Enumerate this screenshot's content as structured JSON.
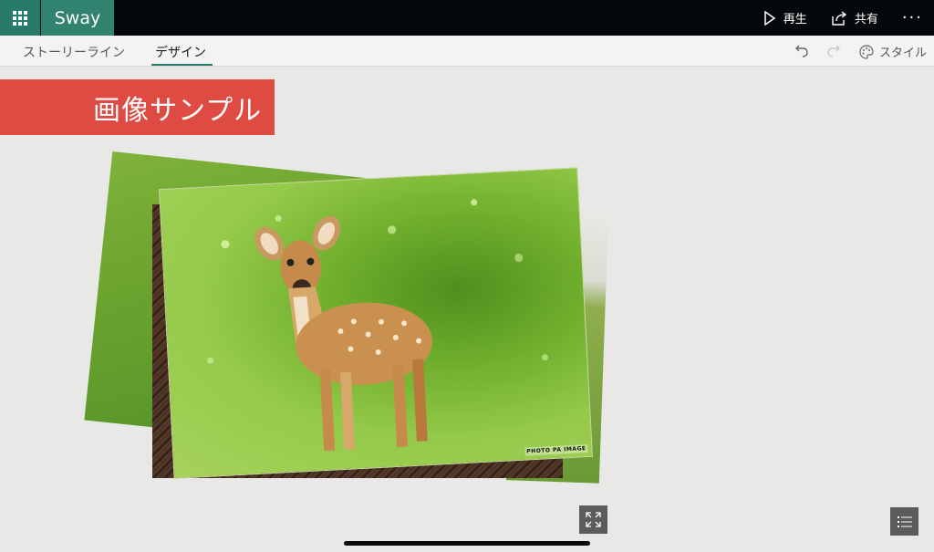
{
  "app": {
    "name": "Sway"
  },
  "topbar": {
    "play_label": "再生",
    "share_label": "共有",
    "more_label": "···"
  },
  "tabs": [
    {
      "label": "ストーリーライン",
      "active": false
    },
    {
      "label": "デザイン",
      "active": true
    }
  ],
  "toolbar": {
    "style_label": "スタイル"
  },
  "card": {
    "title": "画像サンプル",
    "photo_watermark": "PHOTO PA IMAGE"
  },
  "colors": {
    "topbar": "#05080a",
    "brand": "#2a7a6c",
    "title_banner": "#dd4b43",
    "canvas": "#e8e8e7"
  },
  "icons": {
    "waffle": "app-launcher-icon",
    "play": "play-icon",
    "share": "share-icon",
    "more": "more-icon",
    "undo": "undo-icon",
    "redo": "redo-icon",
    "style": "palette-icon",
    "expand": "expand-icon",
    "navigation": "navigation-list-icon"
  }
}
